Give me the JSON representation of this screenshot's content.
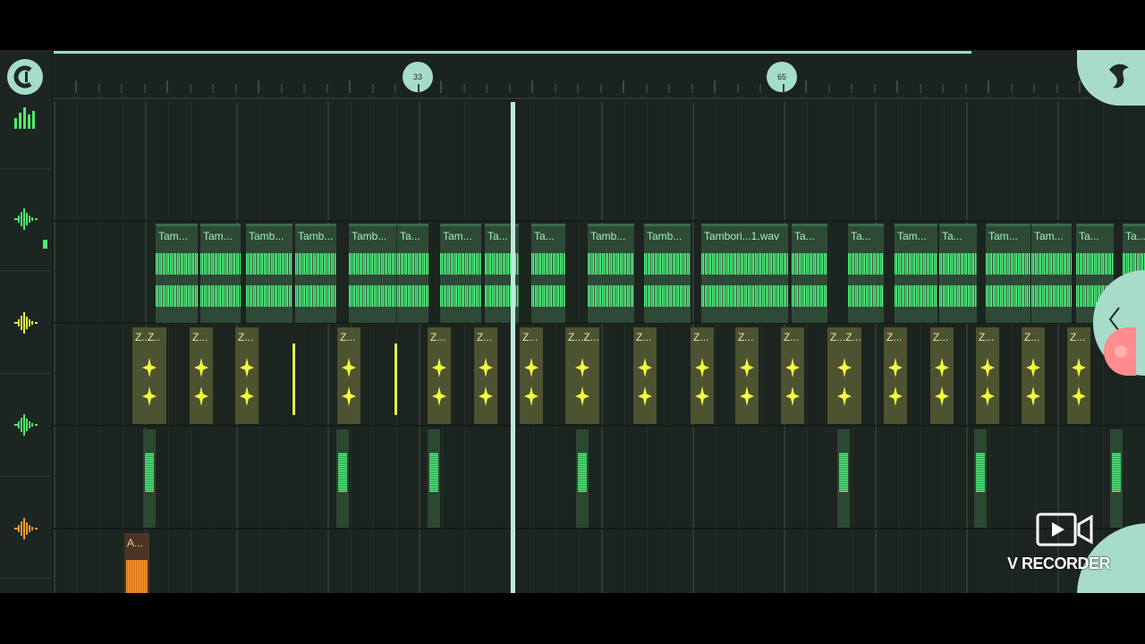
{
  "timeline": {
    "markers": [
      "33",
      "65"
    ]
  },
  "tracks": {
    "tambourine": {
      "clips": [
        "Tam...",
        "Tam...",
        "Tamb...",
        "Tamb...",
        "Tamb...",
        "Ta...",
        "Tam...",
        "Ta...",
        "Ta...",
        "Tamb...",
        "Tamb...",
        "Tambori...1.wav",
        "Ta...",
        "Ta...",
        "Tam...",
        "Ta...",
        "Tam...",
        "Tam...",
        "Ta...",
        "Ta..."
      ]
    },
    "snap": {
      "clips": [
        "Z..Z..",
        "Z...",
        "Z...",
        "Z...",
        "Z...",
        "Z...",
        "Z...",
        "Z...Z...",
        "Z...",
        "Z...",
        "Z...",
        "Z...",
        "Z...Z...",
        "Z...",
        "Z...",
        "Z...",
        "Z...",
        "Z..."
      ]
    },
    "audio": {
      "clip_label": "A..."
    }
  },
  "overlay": {
    "recorder_label": "V RECORDER"
  },
  "colors": {
    "accent": "#a7dccb",
    "wave_green": "#47ff7a",
    "wave_yellow": "#f1ff3c",
    "wave_orange": "#ff9a2e",
    "record_red": "#ff8d8d"
  },
  "icons": [
    "snap-magnet-icon",
    "mixer-icon",
    "waveform-icon",
    "fruit-logo-icon",
    "chevron-left-icon",
    "video-camera-icon"
  ]
}
